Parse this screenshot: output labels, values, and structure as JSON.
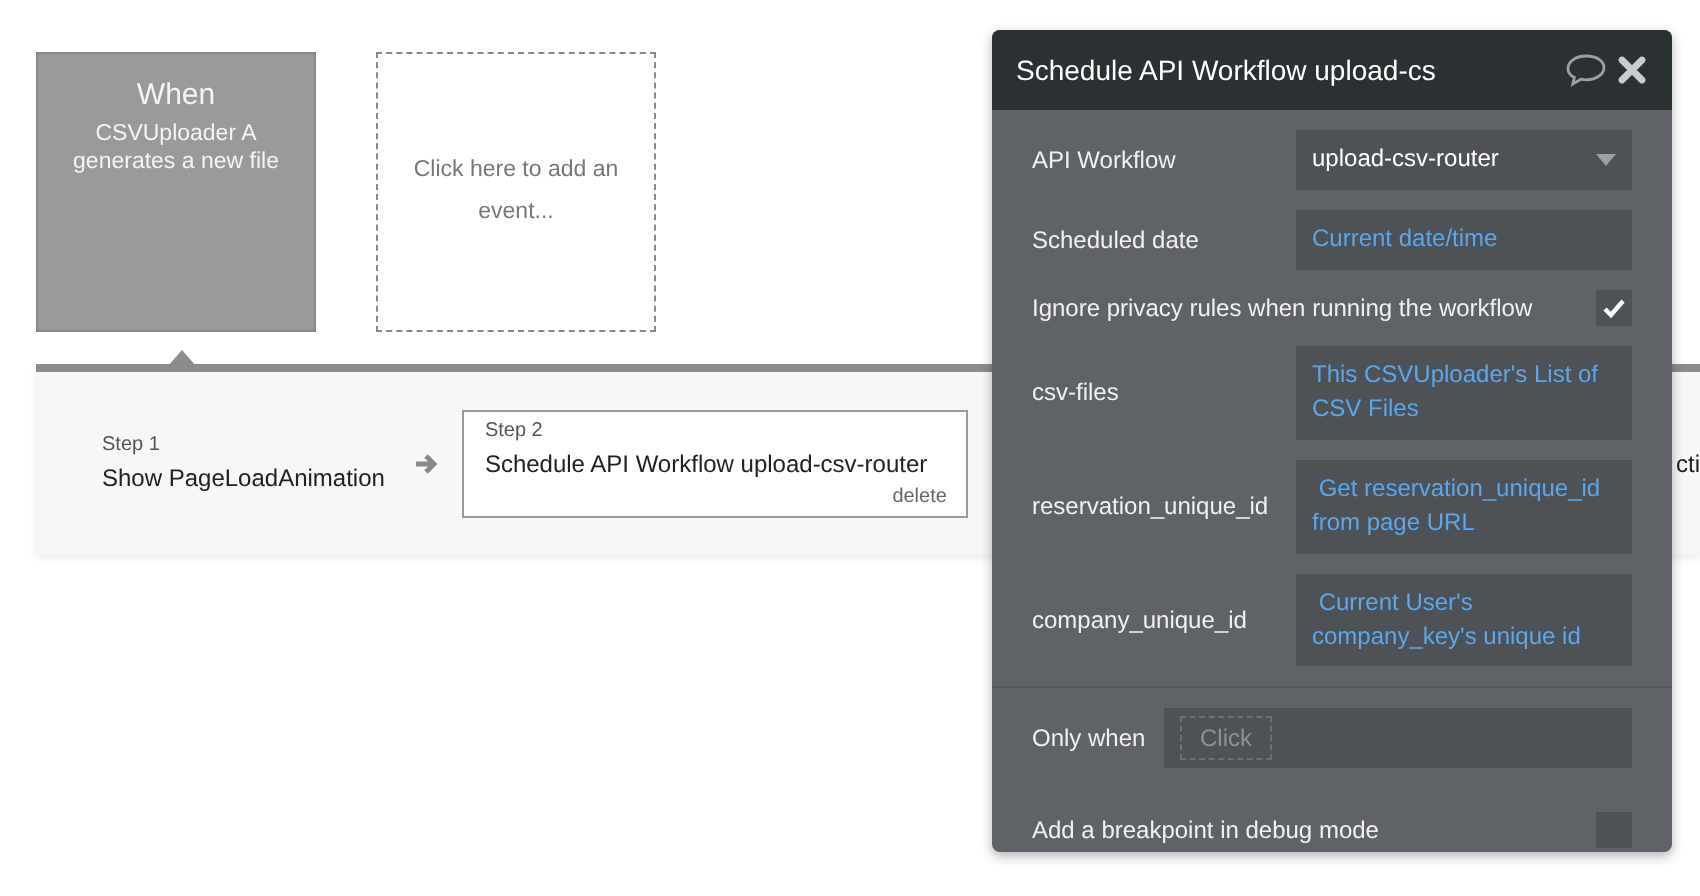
{
  "event": {
    "title": "When",
    "description": "CSVUploader A generates a new file",
    "selected": true
  },
  "add_event": {
    "text": "Click here to add an event..."
  },
  "steps": [
    {
      "label": "Step 1",
      "action": "Show PageLoadAnimation",
      "selected": false
    },
    {
      "label": "Step 2",
      "action": "Schedule API Workflow upload-csv-router",
      "delete": "delete",
      "selected": true
    },
    {
      "action": "cti",
      "selected": false
    }
  ],
  "panel": {
    "title": "Schedule API Workflow upload-cs",
    "rows": [
      {
        "kind": "dropdown",
        "label": "API Workflow",
        "value": "upload-csv-router"
      },
      {
        "kind": "expression",
        "label": "Scheduled date",
        "value": "Current date/time"
      },
      {
        "kind": "checkbox",
        "label": "Ignore privacy rules when running the workflow",
        "checked": true
      },
      {
        "kind": "expression",
        "label": "csv-files",
        "value": "This CSVUploader's List of CSV Files"
      },
      {
        "kind": "expression",
        "label": "reservation_unique_id",
        "value": " Get reservation_unique_id from page URL"
      },
      {
        "kind": "expression",
        "label": "company_unique_id",
        "value": " Current User's company_key's unique id"
      }
    ],
    "only_when": {
      "label": "Only when",
      "placeholder": "Click"
    },
    "breakpoint": {
      "label": "Add a breakpoint in debug mode",
      "checked": false
    }
  }
}
